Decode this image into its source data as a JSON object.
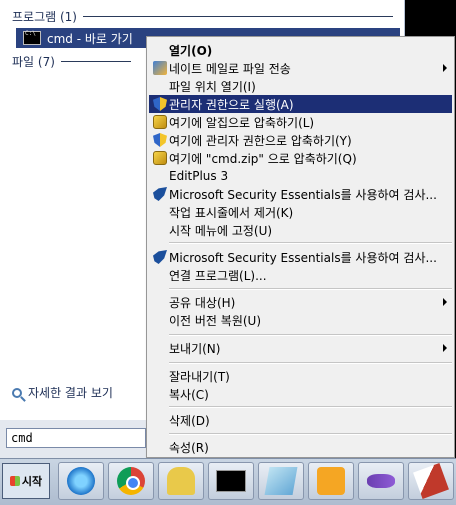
{
  "start_menu": {
    "programs_header": "프로그램 (1)",
    "result_item": "cmd - 바로 가기",
    "files_header": "파일 (7)",
    "see_more": "자세한 결과 보기",
    "search_value": "cmd"
  },
  "context_menu": {
    "items": [
      {
        "label": "열기(O)",
        "icon": "",
        "bold": true,
        "submenu": false
      },
      {
        "label": "네이트 메일로 파일 전송",
        "icon": "mail-icon",
        "submenu": true
      },
      {
        "label": "파일 위치 열기(I)",
        "icon": ""
      },
      {
        "label": "관리자 권한으로 실행(A)",
        "icon": "uac-shield-icon",
        "highlighted": true
      },
      {
        "label": "여기에 알집으로 압축하기(L)",
        "icon": "alzip-icon"
      },
      {
        "label": "여기에 관리자 권한으로 압축하기(Y)",
        "icon": "uac-shield-icon"
      },
      {
        "label": "여기에 \"cmd.zip\" 으로 압축하기(Q)",
        "icon": "alzip-icon"
      },
      {
        "label": "EditPlus 3",
        "icon": ""
      },
      {
        "label": "Microsoft Security Essentials를 사용하여 검사...",
        "icon": "mse-icon"
      },
      {
        "label": "작업 표시줄에서 제거(K)",
        "icon": ""
      },
      {
        "label": "시작 메뉴에 고정(U)",
        "icon": ""
      },
      {
        "label": "Microsoft Security Essentials를 사용하여 검사...",
        "icon": "mse-icon"
      },
      {
        "label": "연결 프로그램(L)...",
        "icon": ""
      },
      {
        "label": "공유 대상(H)",
        "icon": "",
        "submenu": true
      },
      {
        "label": "이전 버전 복원(U)",
        "icon": ""
      },
      {
        "label": "보내기(N)",
        "icon": "",
        "submenu": true
      },
      {
        "label": "잘라내기(T)",
        "icon": ""
      },
      {
        "label": "복사(C)",
        "icon": ""
      },
      {
        "label": "삭제(D)",
        "icon": ""
      },
      {
        "label": "속성(R)",
        "icon": ""
      }
    ]
  },
  "taskbar": {
    "start_label": "시작",
    "buttons": [
      "internet-explorer-icon",
      "chrome-icon",
      "character-app-icon",
      "cmd-icon",
      "notepad-icon",
      "virtualbox-icon",
      "visual-studio-icon",
      "misc-app-icon"
    ]
  },
  "colors": {
    "highlight": "#1c2e75",
    "taskbar": "#b9c6d8"
  }
}
